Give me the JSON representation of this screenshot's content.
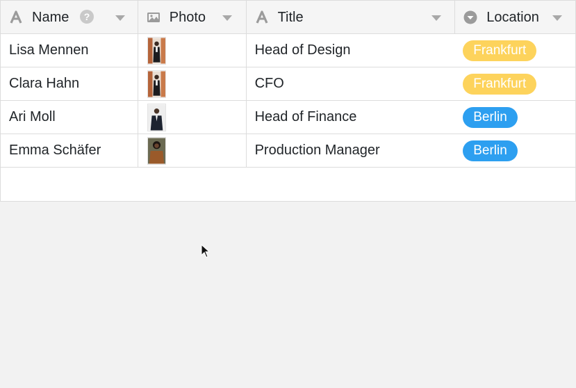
{
  "columns": [
    {
      "id": "name",
      "label": "Name",
      "icon": "text-type-icon",
      "has_help": true,
      "help_glyph": "?"
    },
    {
      "id": "photo",
      "label": "Photo",
      "icon": "image-icon"
    },
    {
      "id": "title",
      "label": "Title",
      "icon": "text-type-icon"
    },
    {
      "id": "location",
      "label": "Location",
      "icon": "single-select-icon"
    }
  ],
  "rows": [
    {
      "name": "Lisa Mennen",
      "photo": "photo-thumbnail",
      "title": "Head of Design",
      "location": "Frankfurt"
    },
    {
      "name": "Clara Hahn",
      "photo": "photo-thumbnail",
      "title": "CFO",
      "location": "Frankfurt"
    },
    {
      "name": "Ari Moll",
      "photo": "photo-thumbnail",
      "title": "Head of Finance",
      "location": "Berlin"
    },
    {
      "name": "Emma Schäfer",
      "photo": "photo-thumbnail",
      "title": "Production Manager",
      "location": "Berlin"
    }
  ],
  "colors": {
    "frankfurt_badge": "#fdd35c",
    "berlin_badge": "#2d9ff0",
    "header_bg": "#f5f5f5",
    "grid_line": "#dcdcdc",
    "header_icon": "#9b9b9b"
  }
}
